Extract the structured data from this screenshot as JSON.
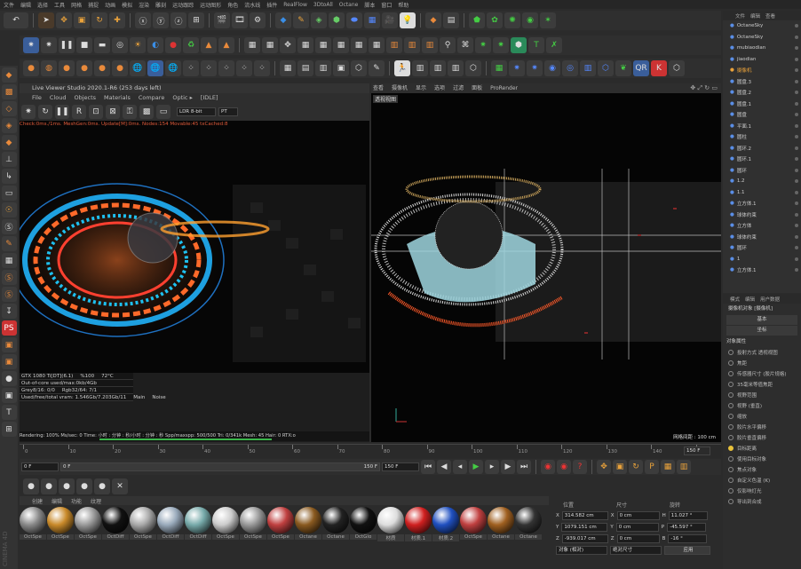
{
  "menubar": [
    "文件",
    "编辑",
    "选择",
    "工具",
    "网格",
    "捕捉",
    "动画",
    "模拟",
    "渲染",
    "雕刻",
    "运动跟踪",
    "运动图形",
    "角色",
    "流水线",
    "插件",
    "RealFlow",
    "3DtoAll",
    "Octane",
    "脚本",
    "窗口",
    "帮助"
  ],
  "live_viewer": {
    "title": "Live Viewer Studio 2020.1-R6 (253 days left)",
    "menu": [
      "File",
      "Cloud",
      "Objects",
      "Materials",
      "Compare",
      "Optic ▸",
      "[IDLE]"
    ],
    "lut": "LDR 8-bit",
    "pt": "PT",
    "status_line": "Check:0ms./1ms. MeshGen:0ms. Update[M]:0ms. Nodes:154 Movable:45 txCached:8",
    "stats": [
      {
        "a": "GTX 1080 Ti[DT](6.1)",
        "b": "%100",
        "c": "72°C"
      },
      {
        "a": "Out-of-core used/max:0kb/4Gb",
        "b": "",
        "c": ""
      },
      {
        "a": "Grey8/16: 0/0",
        "b": "Rgb32/64: 7/1",
        "c": ""
      },
      {
        "a": "Used/free/total vram: 1.546Gb/7.203Gb/11",
        "b": "Main",
        "c": "Noise"
      }
    ],
    "render_bar": "Rendering: 100%   Ms/sec: 0   Time: 小时 : 分钟 : 秒/小时 : 分钟 : 秒   Spp/maxspp: 500/500   Tri: 0/341k   Mesh: 45   Hair: 0   RTX:o"
  },
  "viewport": {
    "menu": [
      "查看",
      "摄像机",
      "显示",
      "选项",
      "过滤",
      "面板",
      "ProRender"
    ],
    "label": "透视视图",
    "grid_label": "网格间距 : 100 cm"
  },
  "timeline": {
    "ticks": [
      "0",
      "10",
      "20",
      "30",
      "40",
      "50",
      "60",
      "70",
      "80",
      "90",
      "100",
      "110",
      "120",
      "130",
      "140",
      "150"
    ],
    "current": "0 F",
    "start": "0 F",
    "end": "150 F",
    "end2": "150 F",
    "max": "150 F"
  },
  "materials": {
    "tabs": [
      "创建",
      "编辑",
      "功能",
      "纹理"
    ],
    "items": [
      {
        "label": "OctSpe",
        "c": "#8a8a8a"
      },
      {
        "label": "OctSpe",
        "c": "#c98a2a"
      },
      {
        "label": "OctSpe",
        "c": "#9a9a9a"
      },
      {
        "label": "OctDiff",
        "c": "#111"
      },
      {
        "label": "OctSpe",
        "c": "#aaa"
      },
      {
        "label": "OctDiff",
        "c": "#9ab"
      },
      {
        "label": "OctDiff",
        "c": "#7aa"
      },
      {
        "label": "OctSpe",
        "c": "#ccc"
      },
      {
        "label": "OctSpe",
        "c": "#999"
      },
      {
        "label": "OctSpe",
        "c": "#c04040"
      },
      {
        "label": "Octane",
        "c": "#8a5a20"
      },
      {
        "label": "Octane",
        "c": "#222"
      },
      {
        "label": "OctGlo",
        "c": "#111"
      },
      {
        "label": "材质",
        "c": "#ddd"
      },
      {
        "label": "材质.1",
        "c": "#d02020"
      },
      {
        "label": "材质.2",
        "c": "#2050c0"
      },
      {
        "label": "OctSpe",
        "c": "#c04040"
      },
      {
        "label": "Octane",
        "c": "#a06020"
      },
      {
        "label": "Octane",
        "c": "#333"
      }
    ]
  },
  "coords": {
    "headers": [
      "位置",
      "尺寸",
      "旋转"
    ],
    "rows": [
      {
        "axis": "X",
        "pos": "314.582 cm",
        "size": "0 cm",
        "rl": "H",
        "rot": "11.027 °"
      },
      {
        "axis": "Y",
        "pos": "1079.151 cm",
        "size": "0 cm",
        "rl": "P",
        "rot": "-45.597 °"
      },
      {
        "axis": "Z",
        "pos": "-939.017 cm",
        "size": "0 cm",
        "rl": "B",
        "rot": "-16 °"
      }
    ],
    "mode1": "对象 (相对)",
    "mode2": "绝对尺寸",
    "apply": "应用"
  },
  "objects": {
    "tabs": [
      "文件",
      "编辑",
      "查看"
    ],
    "items": [
      "OctaneSky",
      "OctaneSky",
      "mubiaodian",
      "jiaodian",
      "摄像机",
      "圆盘.3",
      "圆盘.2",
      "圆盘.1",
      "圆盘",
      "平面.1",
      "圆柱",
      "圆环.2",
      "圆环.1",
      "圆环",
      "1.2",
      "1.1",
      "立方体.1",
      "球体约束",
      "立方体",
      "球体约束",
      "圆环",
      "1",
      "立方体.1"
    ]
  },
  "attributes": {
    "tabs": [
      "模式",
      "编辑",
      "用户数据"
    ],
    "title": "摄像机对象 [摄像机]",
    "subtabs": [
      "基本",
      "坐标"
    ],
    "section": "对象属性",
    "rows": [
      "投射方式  透视视图",
      "焦距",
      "传感器尺寸 (胶片规格)",
      "35毫米等值焦距",
      "视野范围",
      "视野 (垂直)",
      "缩放",
      "胶片水平偏移",
      "胶片垂直偏移",
      "目标距离",
      "使用目标对象",
      "焦点对象",
      "自定义色温 (K)",
      "仅影响灯光",
      "导出到合成"
    ]
  },
  "watermark": "CINEMA 4D"
}
